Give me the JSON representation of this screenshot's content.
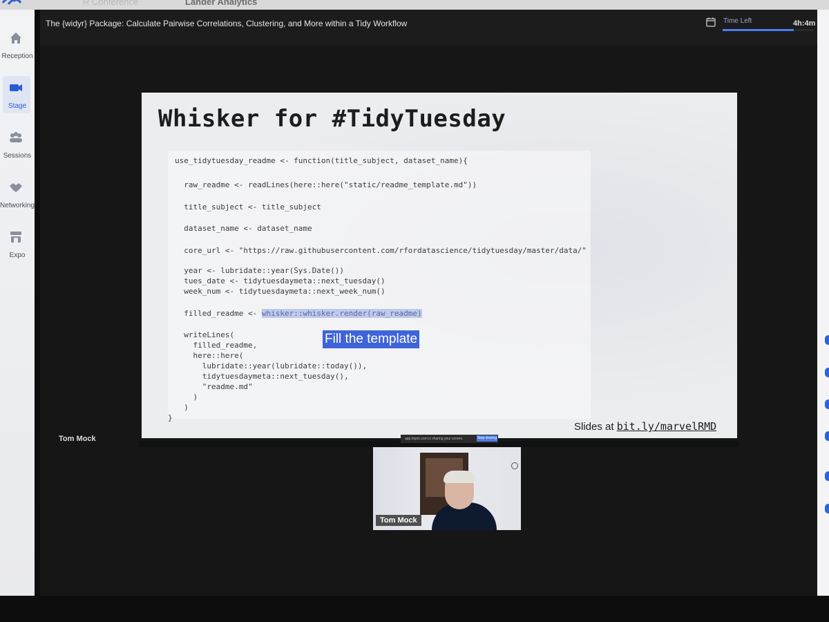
{
  "app": {
    "conference_name": "R Conference",
    "org_name": "Lander Analytics"
  },
  "sidebar": {
    "items": [
      {
        "label": "Reception",
        "icon": "home-icon",
        "active": false
      },
      {
        "label": "Stage",
        "icon": "video-camera-icon",
        "active": true
      },
      {
        "label": "Sessions",
        "icon": "people-icon",
        "active": false
      },
      {
        "label": "Networking",
        "icon": "handshake-icon",
        "active": false
      },
      {
        "label": "Expo",
        "icon": "booth-icon",
        "active": false
      }
    ]
  },
  "session": {
    "title": "The {widyr} Package: Calculate Pairwise Correlations, Clustering, and More within a Tidy Workflow",
    "time_left_label": "Time Left",
    "time_left_value": "4h:4m",
    "time_left_fraction": 0.78
  },
  "slide": {
    "title": "Whisker for #TidyTuesday",
    "code_lines": [
      "use_tidytuesday_readme <- function(title_subject, dataset_name){",
      "  raw_readme <- readLines(here::here(\"static/readme_template.md\"))",
      "  title_subject <- title_subject",
      "  dataset_name <- dataset_name",
      "  core_url <- \"https://raw.githubusercontent.com/rfordatascience/tidytuesday/master/data/\"",
      "  year <- lubridate::year(Sys.Date())",
      "  tues_date <- tidytuesdaymeta::next_tuesday()",
      "  week_num <- tidytuesdaymeta::next_week_num()",
      "  filled_readme <- ",
      "  writeLines(",
      "    filled_readme,",
      "    here::here(",
      "      lubridate::year(lubridate::today()),",
      "      tidytuesdaymeta::next_tuesday(),",
      "      \"readme.md\"",
      "    )",
      "  )",
      "}"
    ],
    "highlighted_code": "whisker::whisker.render(raw_readme)",
    "callout": "Fill the template",
    "slides_at_label": "Slides at",
    "slides_url": "bit.ly/marvelRMD"
  },
  "presenter": {
    "name": "Tom Mock"
  },
  "share_bar": {
    "notice": "app.hopin.com is sharing your screen.",
    "stop_label": "Stop sharing",
    "hide_label": "Hide"
  },
  "video": {
    "name_tag": "Tom Mock"
  }
}
